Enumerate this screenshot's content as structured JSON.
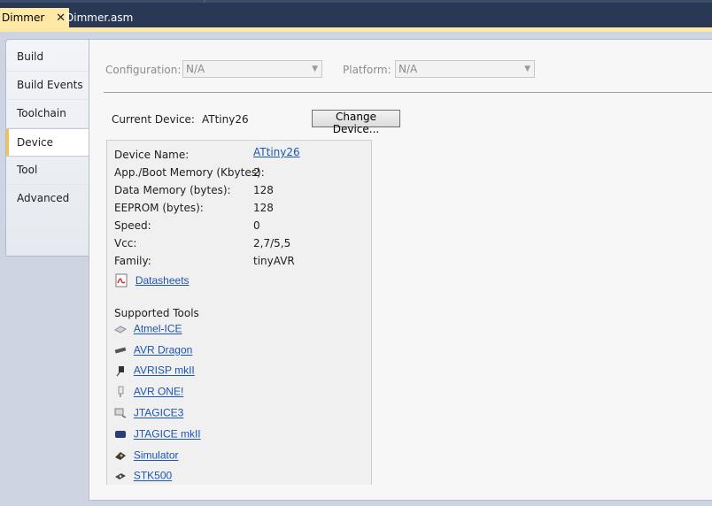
{
  "doc_tabs": {
    "active_label": "Dimmer",
    "close_glyph": "✕",
    "inactive_label": "Dimmer.asm"
  },
  "side_tabs": [
    "Build",
    "Build Events",
    "Toolchain",
    "Device",
    "Tool",
    "Advanced"
  ],
  "config": {
    "configuration_label": "Configuration:",
    "configuration_value": "N/A",
    "platform_label": "Platform:",
    "platform_value": "N/A"
  },
  "current_device": {
    "label": "Current Device:",
    "value": "ATtiny26",
    "change_button": "Change Device..."
  },
  "device_info": {
    "rows": [
      {
        "label": "Device Name:",
        "value": "ATtiny26"
      },
      {
        "label": "App./Boot Memory (Kbytes):",
        "value": "2"
      },
      {
        "label": "Data Memory (bytes):",
        "value": "128"
      },
      {
        "label": "EEPROM (bytes):",
        "value": "128"
      },
      {
        "label": "Speed:",
        "value": "0"
      },
      {
        "label": "Vcc:",
        "value": "2,7/5,5"
      },
      {
        "label": "Family:",
        "value": "tinyAVR"
      }
    ],
    "datasheets_link": "Datasheets"
  },
  "supported_tools": {
    "heading": "Supported Tools",
    "items": [
      {
        "label": "Atmel-ICE",
        "icon": "atmel-ice-icon"
      },
      {
        "label": "AVR Dragon",
        "icon": "avr-dragon-icon"
      },
      {
        "label": "AVRISP mkII",
        "icon": "avrisp-icon"
      },
      {
        "label": "AVR ONE!",
        "icon": "avr-one-icon"
      },
      {
        "label": "JTAGICE3",
        "icon": "jtagice3-icon"
      },
      {
        "label": "JTAGICE mkII",
        "icon": "jtagice-mkii-icon"
      },
      {
        "label": "Simulator",
        "icon": "simulator-icon"
      },
      {
        "label": "STK500",
        "icon": "stk500-icon"
      }
    ]
  },
  "colors": {
    "tabstrip_bg": "#293955",
    "active_tab": "#ffe8a6",
    "link": "#1b55b5",
    "page_bg": "#cdd5e3"
  }
}
